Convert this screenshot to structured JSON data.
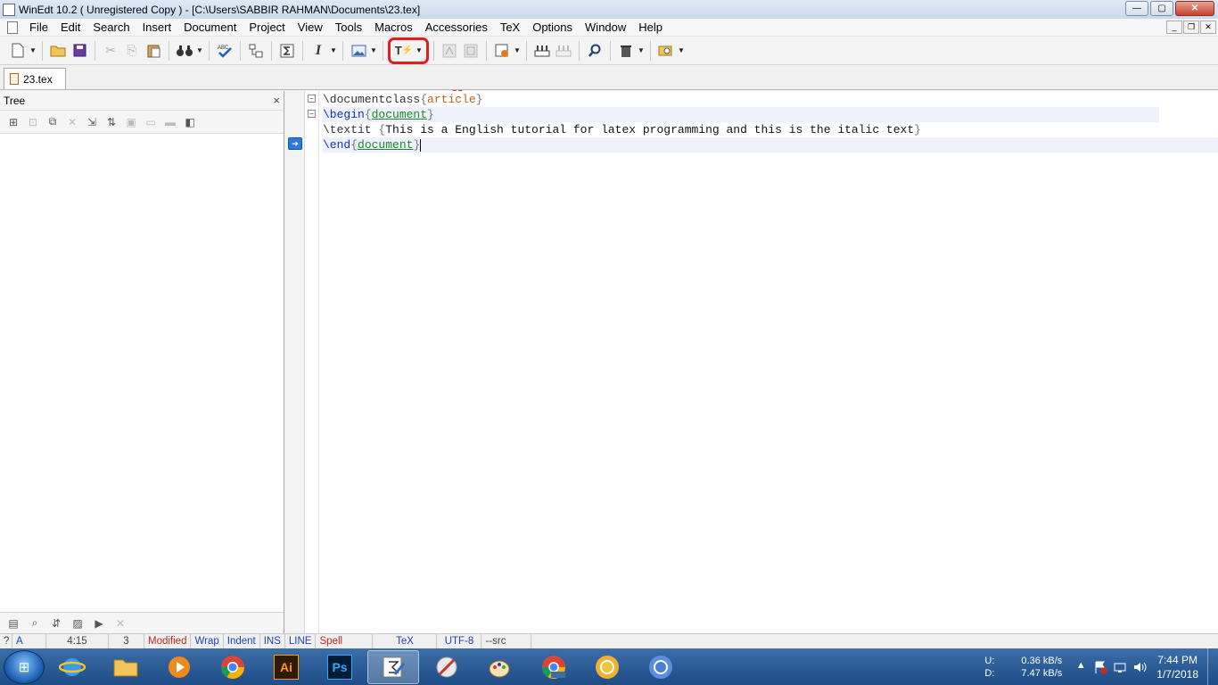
{
  "window": {
    "title": "WinEdt 10.2  ( Unregistered  Copy )  - [C:\\Users\\SABBIR RAHMAN\\Documents\\23.tex]",
    "minimize_glyph": "—",
    "maximize_glyph": "▢",
    "close_glyph": "✕"
  },
  "menu": [
    "File",
    "Edit",
    "Search",
    "Insert",
    "Document",
    "Project",
    "View",
    "Tools",
    "Macros",
    "Accessories",
    "TeX",
    "Options",
    "Window",
    "Help"
  ],
  "mdi_buttons": [
    "_",
    "❐",
    "✕"
  ],
  "toolbar": {
    "icons": [
      "new-document",
      "open-folder",
      "save",
      "cut",
      "copy",
      "paste",
      "find-binoculars",
      "spell-check",
      "tree-structure",
      "sum-insert",
      "italic",
      "image-insert",
      "texify",
      "pdf",
      "pdf-export",
      "compile-options",
      "latex-compile",
      "latex-tools",
      "search-magnifier",
      "trash",
      "settings"
    ],
    "italic_glyph": "I",
    "texify_glyph": "T",
    "highlight_color": "#e01e1e"
  },
  "tabs": [
    {
      "label": "23.tex"
    }
  ],
  "tree": {
    "title": "Tree",
    "close_glyph": "×"
  },
  "editor": {
    "lines": [
      {
        "cmd": "\\documentclass",
        "open": "{",
        "arg": "article",
        "close": "}"
      },
      {
        "cmd": "\\begin",
        "open": "{",
        "arg": "document",
        "close": "}"
      },
      {
        "cmd": "\\textit",
        "sp": " ",
        "open": "{",
        "arg": "This is a English tutorial for latex programming and this is the italic text",
        "close": "}"
      },
      {
        "cmd": "\\end",
        "open": "{",
        "arg": "document",
        "close": "}"
      }
    ],
    "fold_glyph": "−",
    "bookmark_glyph": "➔"
  },
  "statusbar": {
    "help": "?",
    "mode": "A",
    "position": "4:15",
    "lines": "3",
    "modified": "Modified",
    "wrap": "Wrap",
    "indent": "Indent",
    "ins": "INS",
    "line": "LINE",
    "spell": "Spell",
    "tex": "TeX",
    "encoding": "UTF-8",
    "src": "--src"
  },
  "taskbar": {
    "apps": [
      "internet-explorer",
      "file-explorer",
      "media-player",
      "chrome",
      "illustrator",
      "photoshop",
      "winedt",
      "paint-tools",
      "paint",
      "chrome-beta",
      "chrome-canary",
      "chromium"
    ],
    "illustrator_label": "Ai",
    "photoshop_label": "Ps",
    "network": {
      "up_label": "U:",
      "down_label": "D:",
      "up_value": "0.36 kB/s",
      "down_value": "7.47 kB/s"
    },
    "tray_arrow": "▲",
    "time": "7:44 PM",
    "date": "1/7/2018"
  }
}
